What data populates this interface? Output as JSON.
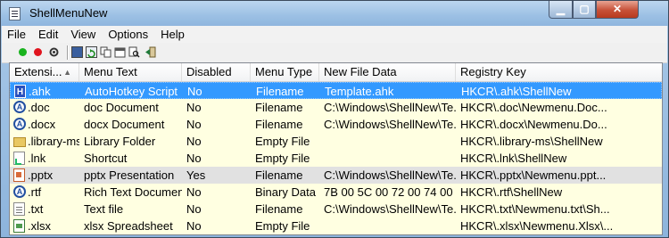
{
  "window": {
    "title": "ShellMenuNew"
  },
  "menu": [
    "File",
    "Edit",
    "View",
    "Options",
    "Help"
  ],
  "toolbar": {
    "buttons": [
      {
        "name": "enable-icon",
        "color": "#19b31e"
      },
      {
        "name": "disable-icon",
        "color": "#e0141e"
      },
      {
        "name": "properties-icon"
      },
      {
        "name": "save-icon"
      },
      {
        "name": "refresh-icon"
      },
      {
        "name": "copy-icon"
      },
      {
        "name": "html-report-icon"
      },
      {
        "name": "find-icon"
      },
      {
        "name": "exit-icon"
      }
    ]
  },
  "table": {
    "columns": [
      "Extensi...",
      "Menu Text",
      "Disabled",
      "Menu Type",
      "New File Data",
      "Registry Key"
    ],
    "sort_indicator": "▲",
    "rows": [
      {
        "icon": "ahk",
        "ext": ".ahk",
        "menu_text": "AutoHotkey Script",
        "disabled": "No",
        "menu_type": "Filename",
        "new_file_data": "Template.ahk",
        "registry_key": "HKCR\\.ahk\\ShellNew",
        "state": "selected"
      },
      {
        "icon": "word",
        "ext": ".doc",
        "menu_text": "doc Document",
        "disabled": "No",
        "menu_type": "Filename",
        "new_file_data": "C:\\Windows\\ShellNew\\Te...",
        "registry_key": "HKCR\\.doc\\Newmenu.Doc...",
        "state": ""
      },
      {
        "icon": "word",
        "ext": ".docx",
        "menu_text": "docx Document",
        "disabled": "No",
        "menu_type": "Filename",
        "new_file_data": "C:\\Windows\\ShellNew\\Te...",
        "registry_key": "HKCR\\.docx\\Newmenu.Do...",
        "state": ""
      },
      {
        "icon": "folder",
        "ext": ".library-ms",
        "menu_text": "Library Folder",
        "disabled": "No",
        "menu_type": "Empty File",
        "new_file_data": "",
        "registry_key": "HKCR\\.library-ms\\ShellNew",
        "state": ""
      },
      {
        "icon": "lnk",
        "ext": ".lnk",
        "menu_text": "Shortcut",
        "disabled": "No",
        "menu_type": "Empty File",
        "new_file_data": "",
        "registry_key": "HKCR\\.lnk\\ShellNew",
        "state": ""
      },
      {
        "icon": "ppt",
        "ext": ".pptx",
        "menu_text": "pptx Presentation",
        "disabled": "Yes",
        "menu_type": "Filename",
        "new_file_data": "C:\\Windows\\ShellNew\\Te...",
        "registry_key": "HKCR\\.pptx\\Newmenu.ppt...",
        "state": "grey"
      },
      {
        "icon": "word",
        "ext": ".rtf",
        "menu_text": "Rich Text Document",
        "disabled": "No",
        "menu_type": "Binary Data",
        "new_file_data": "7B 00 5C 00 72 00 74 00 66...",
        "registry_key": "HKCR\\.rtf\\ShellNew",
        "state": ""
      },
      {
        "icon": "txt",
        "ext": ".txt",
        "menu_text": "Text file",
        "disabled": "No",
        "menu_type": "Filename",
        "new_file_data": "C:\\Windows\\ShellNew\\Te...",
        "registry_key": "HKCR\\.txt\\Newmenu.txt\\Sh...",
        "state": ""
      },
      {
        "icon": "xls",
        "ext": ".xlsx",
        "menu_text": "xlsx Spreadsheet",
        "disabled": "No",
        "menu_type": "Empty File",
        "new_file_data": "",
        "registry_key": "HKCR\\.xlsx\\Newmenu.Xlsx\\...",
        "state": ""
      }
    ]
  }
}
